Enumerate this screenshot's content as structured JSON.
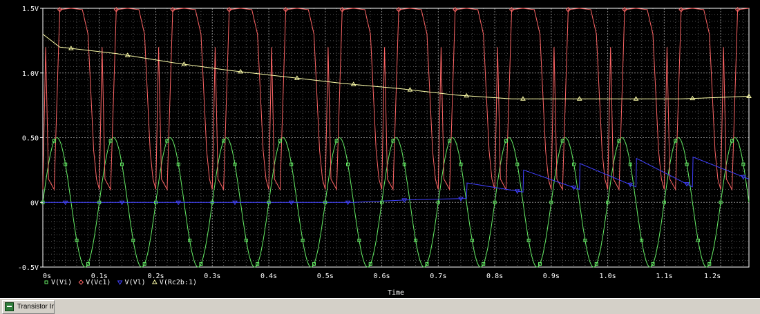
{
  "chart_data": {
    "type": "line",
    "xlabel": "Time",
    "ylabel": "",
    "xlim": [
      0,
      1.25
    ],
    "ylim": [
      -0.5,
      1.5
    ],
    "x_tick_labels": [
      "0s",
      "0.1s",
      "0.2s",
      "0.3s",
      "0.4s",
      "0.5s",
      "0.6s",
      "0.7s",
      "0.8s",
      "0.9s",
      "1.0s",
      "1.1s",
      "1.2s"
    ],
    "y_tick_labels": [
      "-0.5V",
      "0V",
      "0.50",
      "1.0V",
      "1.5V"
    ],
    "y_ticks": [
      -0.5,
      0,
      0.5,
      1.0,
      1.5
    ],
    "grid": true,
    "background": "#000000",
    "legend_position": "bottom-left",
    "series": [
      {
        "name": "V(Vi)",
        "color": "#66ee66",
        "marker": "square",
        "function": "sine",
        "amplitude": 0.5,
        "offset": 0,
        "period": 0.1,
        "x": [
          0,
          0.025,
          0.05,
          0.075,
          0.1,
          0.125,
          0.15,
          0.175,
          0.2
        ],
        "values": [
          0,
          0.5,
          0,
          -0.5,
          0,
          0.5,
          0,
          -0.5,
          0
        ]
      },
      {
        "name": "V(Vc1)",
        "color": "#ff6666",
        "marker": "diamond",
        "x": [
          0,
          0.005,
          0.01,
          0.02,
          0.03,
          0.05,
          0.07,
          0.08,
          0.09,
          0.095,
          0.1
        ],
        "values": [
          0.1,
          1.2,
          0.18,
          0.1,
          1.49,
          1.5,
          1.49,
          1.3,
          0.4,
          0.18,
          0.1
        ]
      },
      {
        "name": "V(Vl)",
        "color": "#4040ff",
        "marker": "triangle-down",
        "x": [
          0,
          0.55,
          0.65,
          0.75,
          0.751,
          0.85,
          0.851,
          0.95,
          0.951,
          1.05,
          1.051,
          1.15,
          1.151,
          1.25
        ],
        "values": [
          0,
          0,
          0.02,
          0.03,
          0.15,
          0.08,
          0.25,
          0.1,
          0.3,
          0.12,
          0.34,
          0.12,
          0.35,
          0.18
        ]
      },
      {
        "name": "V(Rc2b:1)",
        "color": "#ffffaa",
        "marker": "triangle",
        "x": [
          0,
          0.03,
          0.13,
          0.23,
          0.33,
          0.43,
          0.53,
          0.63,
          0.73,
          0.83,
          0.93,
          1.03,
          1.13,
          1.25
        ],
        "values": [
          1.3,
          1.2,
          1.15,
          1.08,
          1.02,
          0.97,
          0.92,
          0.88,
          0.83,
          0.8,
          0.8,
          0.8,
          0.8,
          0.82
        ]
      }
    ]
  },
  "taskbar": {
    "window_label": "Transistor Int..."
  }
}
